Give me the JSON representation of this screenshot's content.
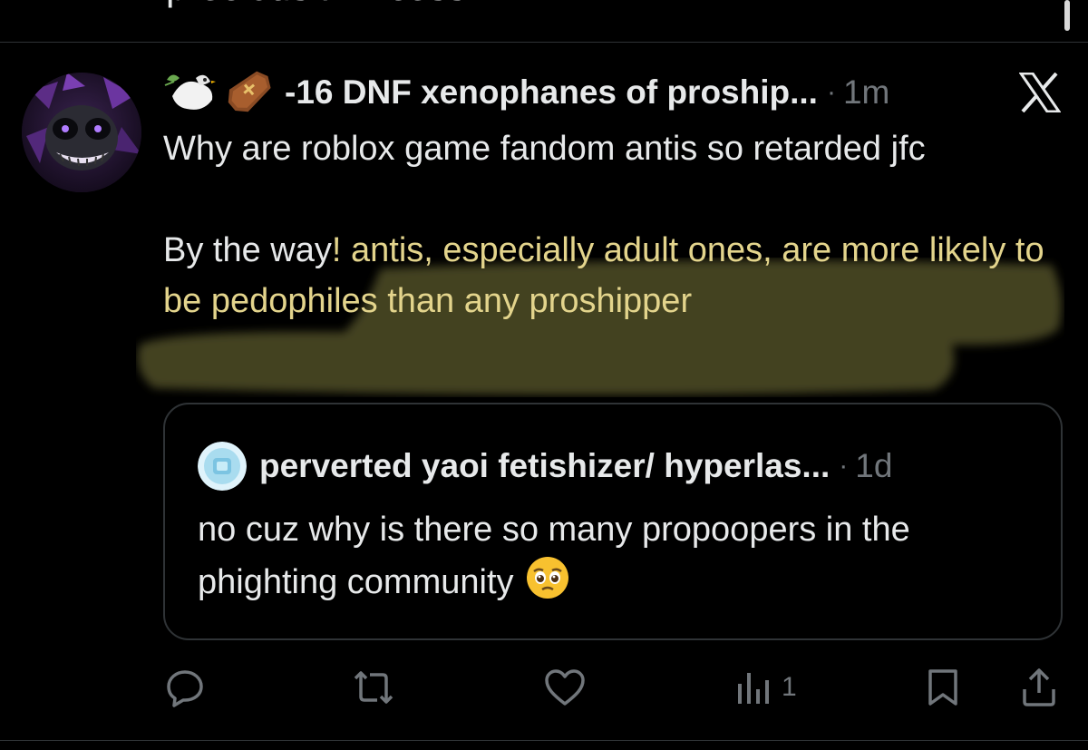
{
  "previous_post": {
    "text_fragment": "precious Princess!"
  },
  "post": {
    "author": {
      "display_name": "-16 DNF xenophanes of proship...",
      "name_emojis": [
        "dove-emoji",
        "coffin-emoji"
      ]
    },
    "timestamp": "1m",
    "platform_icon": "x-logo-icon",
    "text": {
      "line1": "Why are roblox game fandom antis so retarded jfc",
      "line2_plain": "By the way",
      "line2_highlighted": "! antis, especially adult ones, are more likely to be pedophiles than any proshipper"
    },
    "highlight_color": "#e3d48c"
  },
  "quoted_post": {
    "author": {
      "display_name": "perverted yaoi fetishizer/ hyperlas..."
    },
    "timestamp": "1d",
    "text": "no cuz why is there so many propoopers in the phighting community",
    "trailing_emoji": "pleading-face-emoji"
  },
  "actions": {
    "reply_icon": "reply-icon",
    "repost_icon": "repost-icon",
    "like_icon": "heart-icon",
    "views_icon": "views-icon",
    "views_count": "1",
    "bookmark_icon": "bookmark-icon",
    "share_icon": "share-icon"
  },
  "colors": {
    "background": "#000000",
    "text_primary": "#e7e9ea",
    "text_secondary": "#71767b",
    "border": "#2f3336",
    "highlight": "#e3d48c"
  }
}
